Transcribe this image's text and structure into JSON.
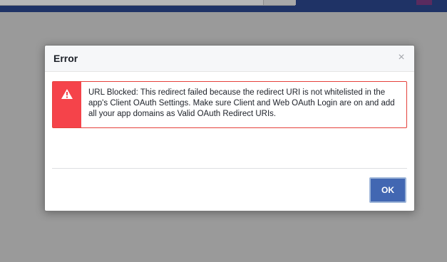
{
  "dialog": {
    "title": "Error",
    "close_glyph": "×",
    "message": "URL Blocked: This redirect failed because the redirect URI is not whitelisted in the app's Client OAuth Settings. Make sure Client and Web OAuth Login are on and add all your app domains as Valid OAuth Redirect URIs.",
    "message_icon": "warning-icon",
    "ok_label": "OK"
  },
  "colors": {
    "error_accent": "#f5434a",
    "primary_button": "#4267b2",
    "topbar": "#1f3366"
  }
}
